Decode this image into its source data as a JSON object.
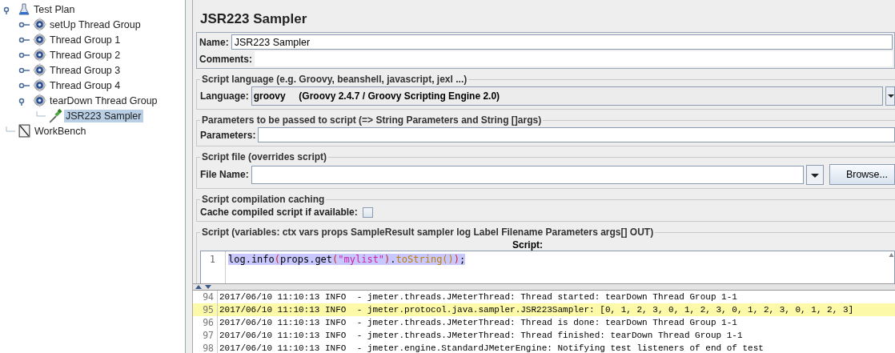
{
  "tree": [
    {
      "label": "Test Plan",
      "kind": "plan",
      "expanded": true,
      "selected": false,
      "children": [
        {
          "label": "setUp Thread Group",
          "kind": "thread_group",
          "expanded": false,
          "selected": false
        },
        {
          "label": "Thread Group 1",
          "kind": "thread_group",
          "expanded": false,
          "selected": false
        },
        {
          "label": "Thread Group 2",
          "kind": "thread_group",
          "expanded": false,
          "selected": false
        },
        {
          "label": "Thread Group 3",
          "kind": "thread_group",
          "expanded": false,
          "selected": false
        },
        {
          "label": "Thread Group 4",
          "kind": "thread_group",
          "expanded": false,
          "selected": false
        },
        {
          "label": "tearDown Thread Group",
          "kind": "thread_group",
          "expanded": true,
          "selected": false,
          "children": [
            {
              "label": "JSR223 Sampler",
              "kind": "sampler",
              "selected": true
            }
          ]
        }
      ]
    },
    {
      "label": "WorkBench",
      "kind": "workbench",
      "selected": false
    }
  ],
  "editor": {
    "title": "JSR223 Sampler",
    "name": {
      "label": "Name:",
      "value": "JSR223 Sampler"
    },
    "comments": {
      "label": "Comments:"
    },
    "language_group": {
      "legend": "Script language (e.g. Groovy, beanshell, javascript, jexl ...)",
      "label": "Language:",
      "value": "groovy     (Groovy 2.4.7 / Groovy Scripting Engine 2.0)"
    },
    "parameters_group": {
      "legend": "Parameters to be passed to script (=> String Parameters and String []args)",
      "label": "Parameters:"
    },
    "file_group": {
      "legend": "Script file (overrides script)",
      "label": "File Name:",
      "button": "Browse..."
    },
    "caching_group": {
      "legend": "Script compilation caching",
      "label": "Cache compiled script if available:",
      "checked": false
    },
    "script_group": {
      "legend": "Script (variables: ctx vars props SampleResult sampler log Label Filename Parameters args[] OUT)",
      "header": "Script:",
      "lines": [
        {
          "number": "1",
          "tokens": [
            {
              "kind": "plain",
              "text": "log.info"
            },
            {
              "kind": "paren",
              "text": "("
            },
            {
              "kind": "plain",
              "text": "props.get"
            },
            {
              "kind": "paren",
              "text": "("
            },
            {
              "kind": "string",
              "text": "\"mylist\""
            },
            {
              "kind": "paren",
              "text": ")"
            },
            {
              "kind": "plain",
              "text": "."
            },
            {
              "kind": "method",
              "text": "toString"
            },
            {
              "kind": "method",
              "text": "()"
            },
            {
              "kind": "paren",
              "text": ")"
            },
            {
              "kind": "plain",
              "text": ";"
            }
          ]
        }
      ]
    }
  },
  "log": [
    {
      "number": "94",
      "text": "2017/06/10 11:10:13 INFO  - jmeter.threads.JMeterThread: Thread started: tearDown Thread Group 1-1",
      "highlighted": false
    },
    {
      "number": "95",
      "text": "2017/06/10 11:10:13 INFO  - jmeter.protocol.java.sampler.JSR223Sampler: [0, 1, 2, 3, 0, 1, 2, 3, 0, 1, 2, 3, 0, 1, 2, 3]",
      "highlighted": true
    },
    {
      "number": "96",
      "text": "2017/06/10 11:10:13 INFO  - jmeter.threads.JMeterThread: Thread is done: tearDown Thread Group 1-1",
      "highlighted": false
    },
    {
      "number": "97",
      "text": "2017/06/10 11:10:13 INFO  - jmeter.threads.JMeterThread: Thread finished: tearDown Thread Group 1-1",
      "highlighted": false
    },
    {
      "number": "98",
      "text": "2017/06/10 11:10:13 INFO  - jmeter.engine.StandardJMeterEngine: Notifying test listeners of end of test",
      "highlighted": false
    }
  ]
}
